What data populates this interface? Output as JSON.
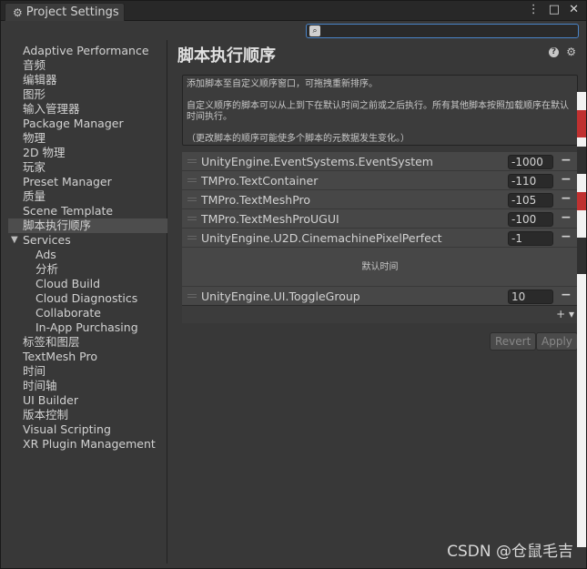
{
  "window": {
    "tab_title": "Project Settings",
    "controls": [
      "⋮",
      "□",
      "✕"
    ]
  },
  "search": {
    "placeholder": ""
  },
  "sidebar": {
    "items": [
      "Adaptive Performance",
      "音频",
      "编辑器",
      "图形",
      "输入管理器",
      "Package Manager",
      "物理",
      "2D 物理",
      "玩家",
      "Preset Manager",
      "质量",
      "Scene Template",
      "脚本执行顺序",
      "Services",
      "Ads",
      "分析",
      "Cloud Build",
      "Cloud Diagnostics",
      "Collaborate",
      "In-App Purchasing",
      "标签和图层",
      "TextMesh Pro",
      "时间",
      "时间轴",
      "UI Builder",
      "版本控制",
      "Visual Scripting",
      "XR Plugin Management"
    ],
    "selected": "脚本执行顺序"
  },
  "main": {
    "title": "脚本执行顺序",
    "info": {
      "line1": "添加脚本至自定义顺序窗口，可拖拽重新排序。",
      "line2": "自定义顺序的脚本可以从上到下在默认时间之前或之后执行。所有其他脚本按照加载顺序在默认时间执行。",
      "line3": "（更改脚本的顺序可能使多个脚本的元数据发生变化。）"
    },
    "rows_before": [
      {
        "name": "UnityEngine.EventSystems.EventSystem",
        "order": "-1000"
      },
      {
        "name": "TMPro.TextContainer",
        "order": "-110"
      },
      {
        "name": "TMPro.TextMeshPro",
        "order": "-105"
      },
      {
        "name": "TMPro.TextMeshProUGUI",
        "order": "-100"
      },
      {
        "name": "UnityEngine.U2D.CinemachinePixelPerfect",
        "order": "-1"
      }
    ],
    "default_time_label": "默认时间",
    "rows_after": [
      {
        "name": "UnityEngine.UI.ToggleGroup",
        "order": "10"
      }
    ],
    "add_label": "+ ▾",
    "revert_label": "Revert",
    "apply_label": "Apply"
  },
  "watermark": "CSDN @仓鼠毛吉",
  "colors": {
    "background": "#383838",
    "selected": "#4d4d4d",
    "search_border": "#4a84c8"
  }
}
